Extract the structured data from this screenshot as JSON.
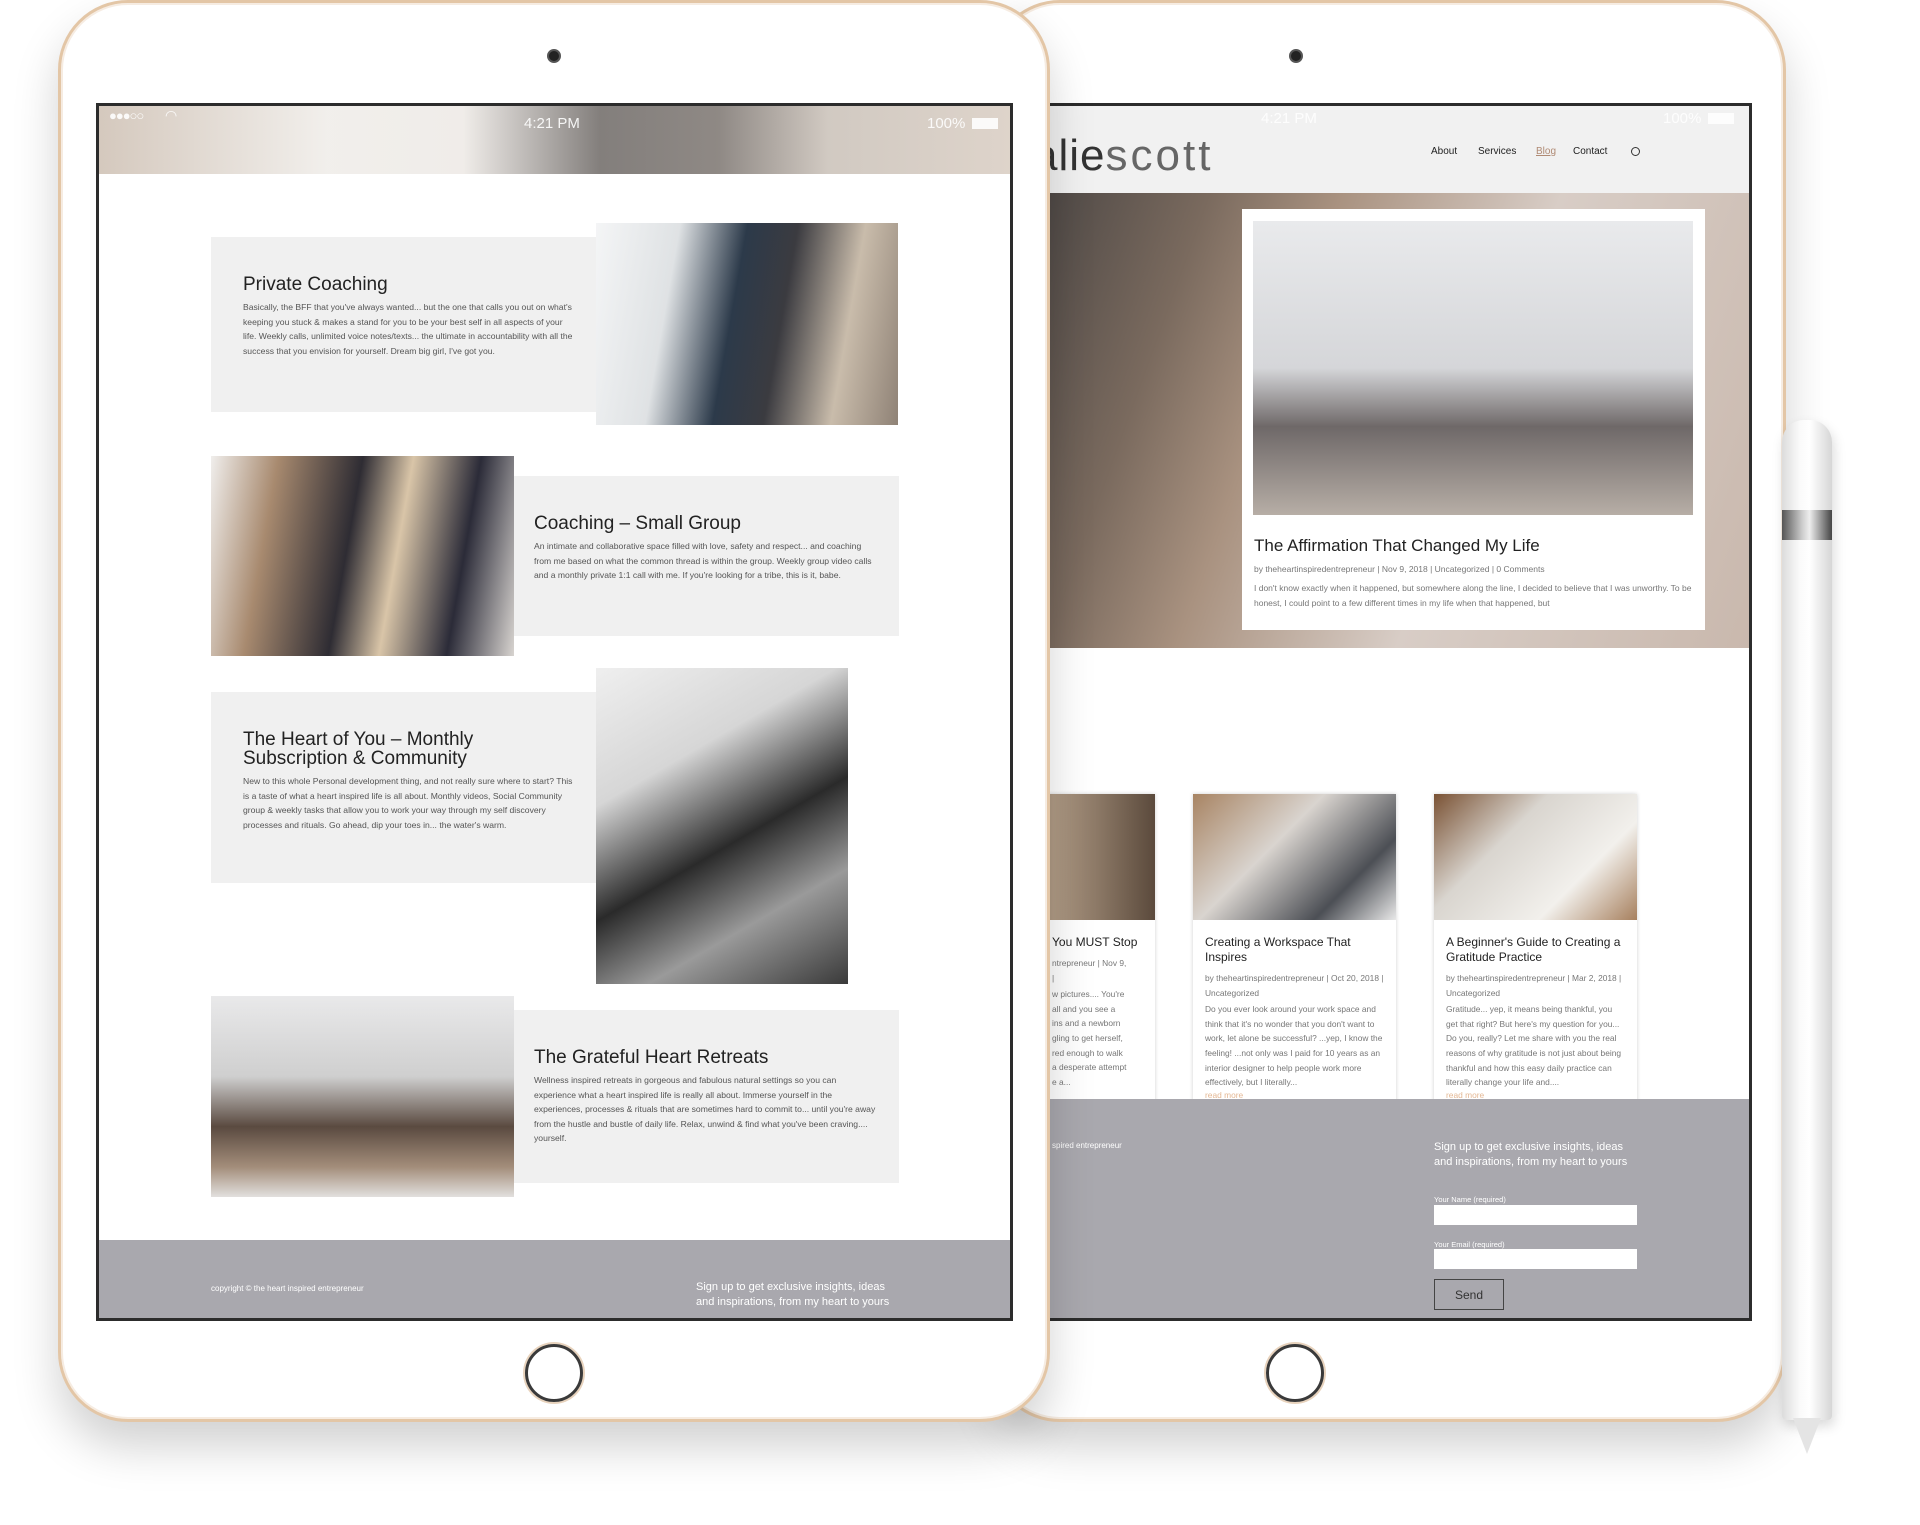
{
  "left_ipad": {
    "status": {
      "time": "4:21 PM",
      "battery": "100%"
    },
    "services": [
      {
        "title": "Private Coaching",
        "text": "Basically, the BFF that you've always wanted... but the one that calls you out on what's keeping you stuck & makes a stand for you to be your best self in all aspects of your life. Weekly calls, unlimited voice notes/texts... the ultimate in accountability with all the success that you envision for yourself. Dream big girl, I've got you."
      },
      {
        "title": "Coaching – Small Group",
        "text": "An intimate and collaborative space filled with love, safety and respect... and coaching from me based on what the common thread is within the group. Weekly group video calls and a monthly private 1:1 call with me. If you're looking for a tribe, this is it, babe."
      },
      {
        "title": "The Heart of You – Monthly Subscription & Community",
        "text": "New to this whole Personal development thing, and not really sure where to start? This is a taste of what a heart inspired life is all about. Monthly videos, Social Community group & weekly tasks that allow you to work your way through my self discovery processes and rituals. Go ahead, dip your toes in... the water's warm."
      },
      {
        "title": "The Grateful Heart Retreats",
        "text": "Wellness inspired retreats in gorgeous and fabulous natural settings so you can experience what a heart inspired life is really all about. Immerse yourself in the experiences, processes & rituals that are sometimes hard to commit to... until you're away from the hustle and bustle of daily life. Relax, unwind & find what you've been craving.... yourself."
      }
    ],
    "footer": {
      "copyright": "copyright © the heart inspired entrepreneur",
      "signup": "Sign up to get exclusive insights, ideas and inspirations, from my heart to yours"
    }
  },
  "right_ipad": {
    "status": {
      "time": "4:21 PM",
      "battery": "100%"
    },
    "logo": {
      "part1": "alie",
      "part2": "scott"
    },
    "nav": [
      "About",
      "Services",
      "Blog",
      "Contact"
    ],
    "accent": "#b08a74",
    "featured": {
      "title": "The Affirmation That Changed My Life",
      "meta": "by theheartinspiredentrepreneur | Nov 9, 2018 | Uncategorized | 0 Comments",
      "excerpt": "I don't know exactly when it happened, but somewhere along the line, I decided to believe that I was unworthy.  To be honest, I could point to a few different times in my life when that happened, but"
    },
    "posts": [
      {
        "title": "You MUST Stop",
        "meta_lines": [
          "ntrepreneur | Nov 9,",
          "|"
        ],
        "excerpt_lines": [
          "w pictures.... You're",
          "all and you see a",
          "ins and a newborn",
          "gling to get herself,",
          "red enough to walk",
          "a desperate attempt",
          "e a..."
        ]
      },
      {
        "title": "Creating a Workspace That Inspires",
        "meta": "by theheartinspiredentrepreneur | Oct 20, 2018 | Uncategorized",
        "excerpt": "Do you ever look around your work space and think that it's no wonder that you don't want to work, let alone be successful?  ...yep, I know the feeling! ...not only was I paid for 10 years as an interior designer to help people work more effectively, but I literally...",
        "more": "read more"
      },
      {
        "title": "A Beginner's Guide to Creating a Gratitude Practice",
        "meta": "by theheartinspiredentrepreneur | Mar 2, 2018 | Uncategorized",
        "excerpt": "Gratitude... yep, it means being thankful, you get that right?  But here's my question for you... Do you, really?  Let me share with you the real reasons of why gratitude is not just about being thankful and how this easy daily practice can literally change your life and....",
        "more": "read more"
      }
    ],
    "footer": {
      "copyright_fragment": "spired entrepreneur",
      "signup": "Sign up to get exclusive insights, ideas and inspirations, from my heart to yours",
      "name_label": "Your Name (required)",
      "email_label": "Your Email (required)",
      "send": "Send"
    }
  }
}
